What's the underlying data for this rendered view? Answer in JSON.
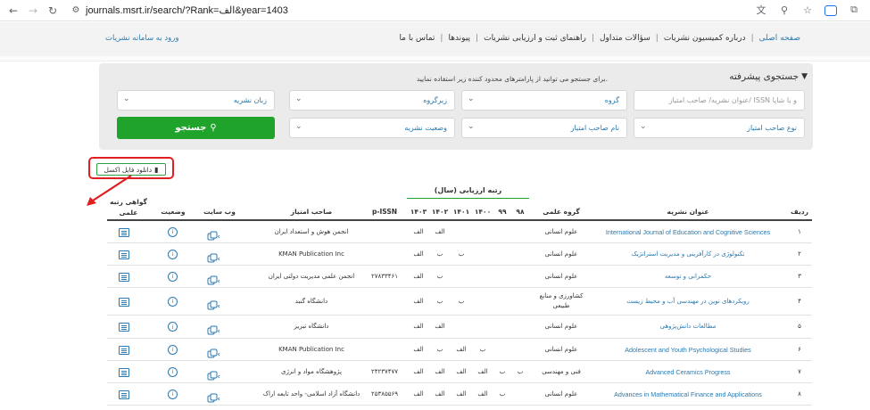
{
  "browser": {
    "url": "journals.msrt.ir/search/?Rank=الف&year=1403"
  },
  "nav": {
    "items": [
      {
        "label": "صفحه اصلی",
        "active": true
      },
      {
        "label": "درباره کمیسیون نشریات",
        "active": false
      },
      {
        "label": "سؤالات متداول",
        "active": false
      },
      {
        "label": "راهنمای ثبت و ارزیابی نشریات",
        "active": false
      },
      {
        "label": "پیوندها",
        "active": false
      },
      {
        "label": "تماس با ما",
        "active": false
      }
    ],
    "login": "ورود به سامانه نشریات"
  },
  "search": {
    "title": "جستجوی پیشرفته",
    "hint": "برای جستجو می توانید از پارامترهای محدود کننده زیر استفاده نمایید.",
    "fields": {
      "title_issn": "عنوان نشریه/ صاحب امتیاز/ ISSN و یا شاپا",
      "group": "گروه",
      "subgroup": "زیرگروه",
      "language": "زبان نشریه",
      "owner_type": "نوع صاحب امتیاز",
      "owner_name": "نام صاحب امتیاز",
      "status": "وضعیت نشریه"
    },
    "button": "جستجو"
  },
  "excel_button": "دانلود فایل اکسل",
  "table": {
    "group_header": "رتبه ارزیابی (سال)",
    "headers": {
      "index": "ردیف",
      "title": "عنوان نشریه",
      "group": "گروه علمی",
      "y98": "۹۸",
      "y99": "۹۹",
      "y1400": "۱۴۰۰",
      "y1401": "۱۴۰۱",
      "y1402": "۱۴۰۲",
      "y1403": "۱۴۰۳",
      "pissn": "p-ISSN",
      "owner": "صاحب امتیاز",
      "website": "وب سایت",
      "status": "وضعیت",
      "cert": "گواهی رتبه علمی"
    },
    "rows": [
      {
        "index": "۱",
        "title": "International Journal of Education and Cognitive Sciences",
        "group": "علوم انسانی",
        "y98": "",
        "y99": "",
        "y1400": "",
        "y1401": "",
        "y1402": "الف",
        "y1403": "الف",
        "pissn": "",
        "owner": "انجمن هوش و استعداد ایران"
      },
      {
        "index": "۲",
        "title": "تکنولوژی در کارآفرینی و مدیریت استراتژیک",
        "group": "علوم انسانی",
        "y98": "",
        "y99": "",
        "y1400": "",
        "y1401": "ب",
        "y1402": "ب",
        "y1403": "الف",
        "pissn": "",
        "owner": "KMAN Publication Inc"
      },
      {
        "index": "۳",
        "title": "حکمرانی و توسعه",
        "group": "علوم انسانی",
        "y98": "",
        "y99": "",
        "y1400": "",
        "y1401": "",
        "y1402": "ب",
        "y1403": "الف",
        "pissn": "۲۷۸۳۳۴۶۱",
        "owner": "انجمن علمی مدیریت دولتی ایران"
      },
      {
        "index": "۴",
        "title": "رویکردهای نوین در مهندسی آب و محیط زیست",
        "group": "کشاورزی و منابع طبیعی",
        "y98": "",
        "y99": "",
        "y1400": "",
        "y1401": "ب",
        "y1402": "ب",
        "y1403": "الف",
        "pissn": "",
        "owner": "دانشگاه گنبد"
      },
      {
        "index": "۵",
        "title": "مطالعات دانش‌پژوهی",
        "group": "علوم انسانی",
        "y98": "",
        "y99": "",
        "y1400": "",
        "y1401": "",
        "y1402": "الف",
        "y1403": "الف",
        "pissn": "",
        "owner": "دانشگاه تبریز"
      },
      {
        "index": "۶",
        "title": "Adolescent and Youth Psychological Studies",
        "group": "علوم انسانی",
        "y98": "",
        "y99": "",
        "y1400": "ب",
        "y1401": "الف",
        "y1402": "ب",
        "y1403": "الف",
        "pissn": "",
        "owner": "KMAN Publication Inc"
      },
      {
        "index": "۷",
        "title": "Advanced Ceramics Progress",
        "group": "فنی و مهندسی",
        "y98": "ب",
        "y99": "ب",
        "y1400": "الف",
        "y1401": "الف",
        "y1402": "الف",
        "y1403": "الف",
        "pissn": "۲۴۲۳۷۴۷۷",
        "owner": "پژوهشگاه مواد و انرژی"
      },
      {
        "index": "۸",
        "title": "Advances in Mathematical Finance and Applications",
        "group": "علوم انسانی",
        "y98": "",
        "y99": "ب",
        "y1400": "الف",
        "y1401": "الف",
        "y1402": "الف",
        "y1403": "الف",
        "pissn": "۲۵۳۸۵۵۶۹",
        "owner": "دانشگاه آزاد اسلامی- واحد تابعه اراک"
      }
    ]
  },
  "colors": {
    "accent": "#2a7ab0",
    "search_button": "#1fa32a",
    "highlight": "#e02020"
  }
}
